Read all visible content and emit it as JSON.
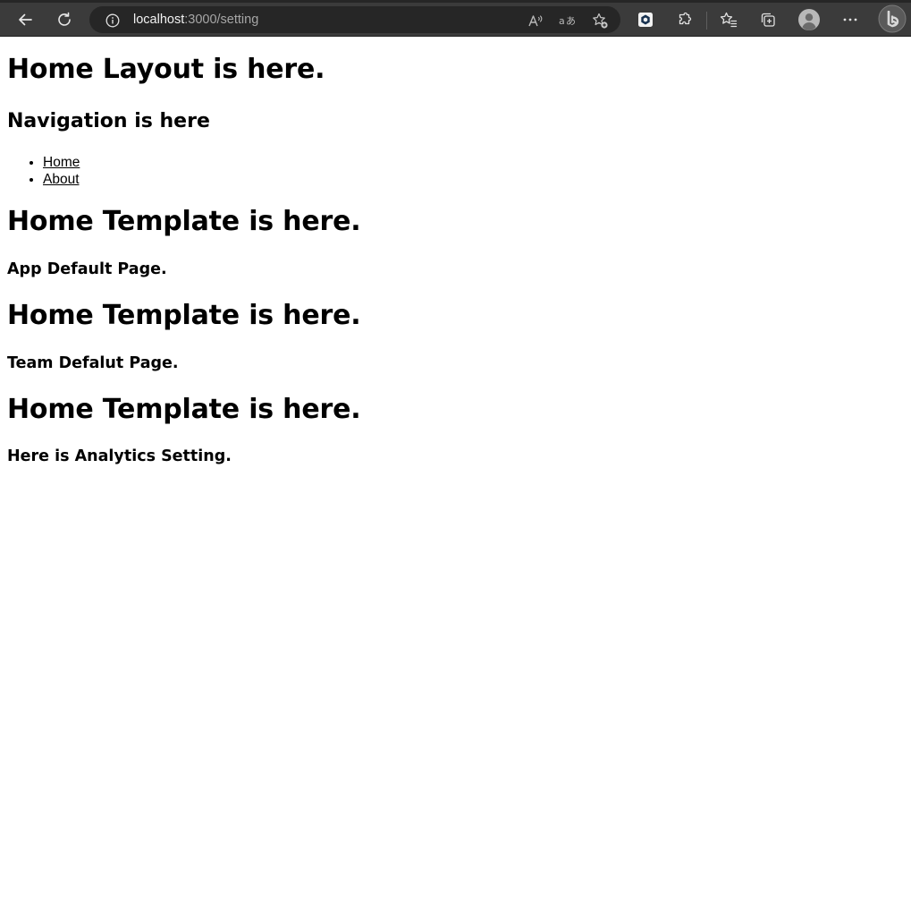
{
  "browser": {
    "url_host": "localhost",
    "url_path": ":3000/setting",
    "icons": {
      "back": "back-arrow-icon",
      "reload": "reload-icon",
      "site_info": "info-icon",
      "read_aloud": "read-aloud-icon",
      "translate": "translate-icon",
      "add_favorite": "add-favorite-icon",
      "extension_app": "extension-app-icon",
      "extensions": "puzzle-icon",
      "favorites": "favorites-icon",
      "collections": "collections-icon",
      "profile": "profile-avatar-icon",
      "more": "more-icon",
      "copilot": "bing-icon"
    }
  },
  "page": {
    "layout_heading": "Home Layout is here.",
    "nav_heading": "Navigation is here",
    "nav_links": [
      "Home",
      "About"
    ],
    "sections": [
      {
        "template_heading": "Home Template is here.",
        "page_text": "App Default Page."
      },
      {
        "template_heading": "Home Template is here.",
        "page_text": "Team Defalut Page."
      },
      {
        "template_heading": "Home Template is here.",
        "page_text": "Here is Analytics Setting."
      }
    ]
  }
}
